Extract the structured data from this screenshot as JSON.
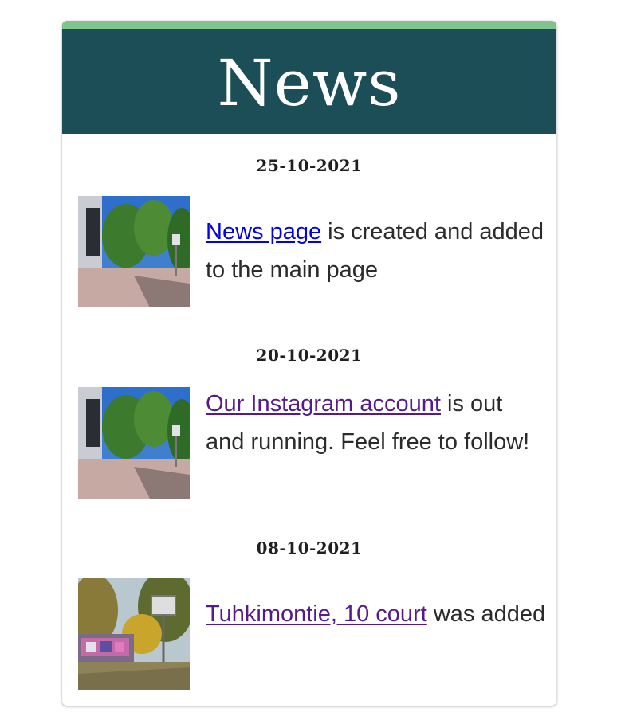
{
  "header": {
    "title": "News"
  },
  "news": [
    {
      "date": "25-10-2021",
      "link_text": "News page",
      "rest_text": " is created and added to the main page",
      "image_icon": "park-photo"
    },
    {
      "date": "20-10-2021",
      "link_text": "Our Instagram account",
      "rest_text": " is out and running. Feel free to follow!",
      "image_icon": "park-photo"
    },
    {
      "date": "08-10-2021",
      "link_text": "Tuhkimontie, 10 court",
      "rest_text": " was added",
      "image_icon": "graffiti-court-photo"
    }
  ],
  "colors": {
    "accent_bar": "#7fc48f",
    "header_bg": "#1b4e56",
    "link_unvisited": "#0000ee",
    "link_visited": "#551a8b"
  }
}
